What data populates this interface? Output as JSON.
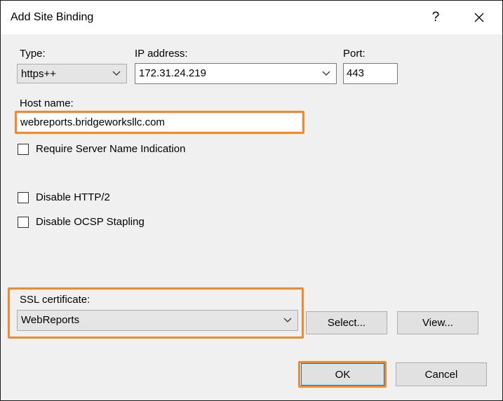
{
  "dialog": {
    "title": "Add Site Binding",
    "help_label": "?",
    "close_icon": "close-icon"
  },
  "type": {
    "label": "Type:",
    "value": "https++"
  },
  "ip": {
    "label": "IP address:",
    "value": "172.31.24.219"
  },
  "port": {
    "label": "Port:",
    "value": "443"
  },
  "host": {
    "label": "Host name:",
    "value": "webreports.bridgeworksllc.com"
  },
  "checkboxes": {
    "sni": {
      "label": "Require Server Name Indication",
      "checked": false
    },
    "http2": {
      "label": "Disable HTTP/2",
      "checked": false
    },
    "ocsp": {
      "label": "Disable OCSP Stapling",
      "checked": false
    }
  },
  "ssl": {
    "label": "SSL certificate:",
    "value": "WebReports"
  },
  "buttons": {
    "select": "Select...",
    "view": "View...",
    "ok": "OK",
    "cancel": "Cancel"
  },
  "colors": {
    "highlight": "#f08a2c",
    "dialog_bg": "#f0f0f0",
    "accent": "#0078d7"
  }
}
